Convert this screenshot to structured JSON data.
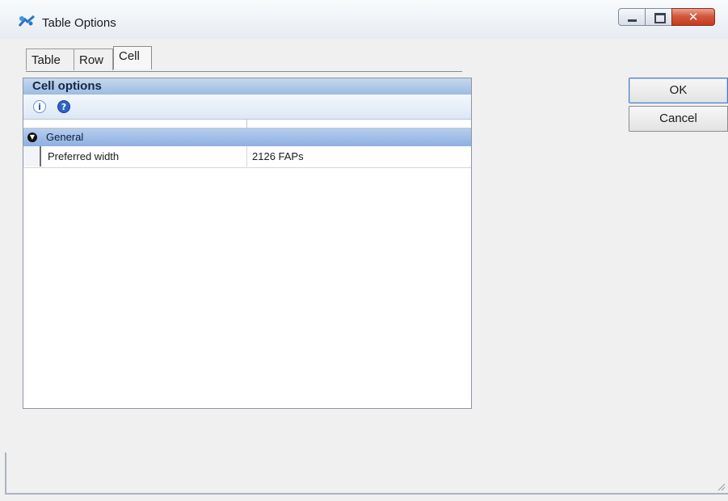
{
  "window": {
    "title": "Table Options",
    "close_glyph": "✕"
  },
  "tabs": [
    {
      "label": "Table"
    },
    {
      "label": "Row"
    },
    {
      "label": "Cell"
    }
  ],
  "panel": {
    "header": "Cell options",
    "toolbar": {
      "info_glyph": "i",
      "help_glyph": "?"
    },
    "category": {
      "toggle_glyph": "▼",
      "label": "General"
    },
    "properties": [
      {
        "name": "Preferred width",
        "value": "2126 FAPs"
      }
    ]
  },
  "buttons": {
    "ok": "OK",
    "cancel": "Cancel"
  },
  "colors": {
    "panel_header": "#9ebce2",
    "category_row": "#8fb0e0",
    "close_button": "#c43b1f"
  }
}
